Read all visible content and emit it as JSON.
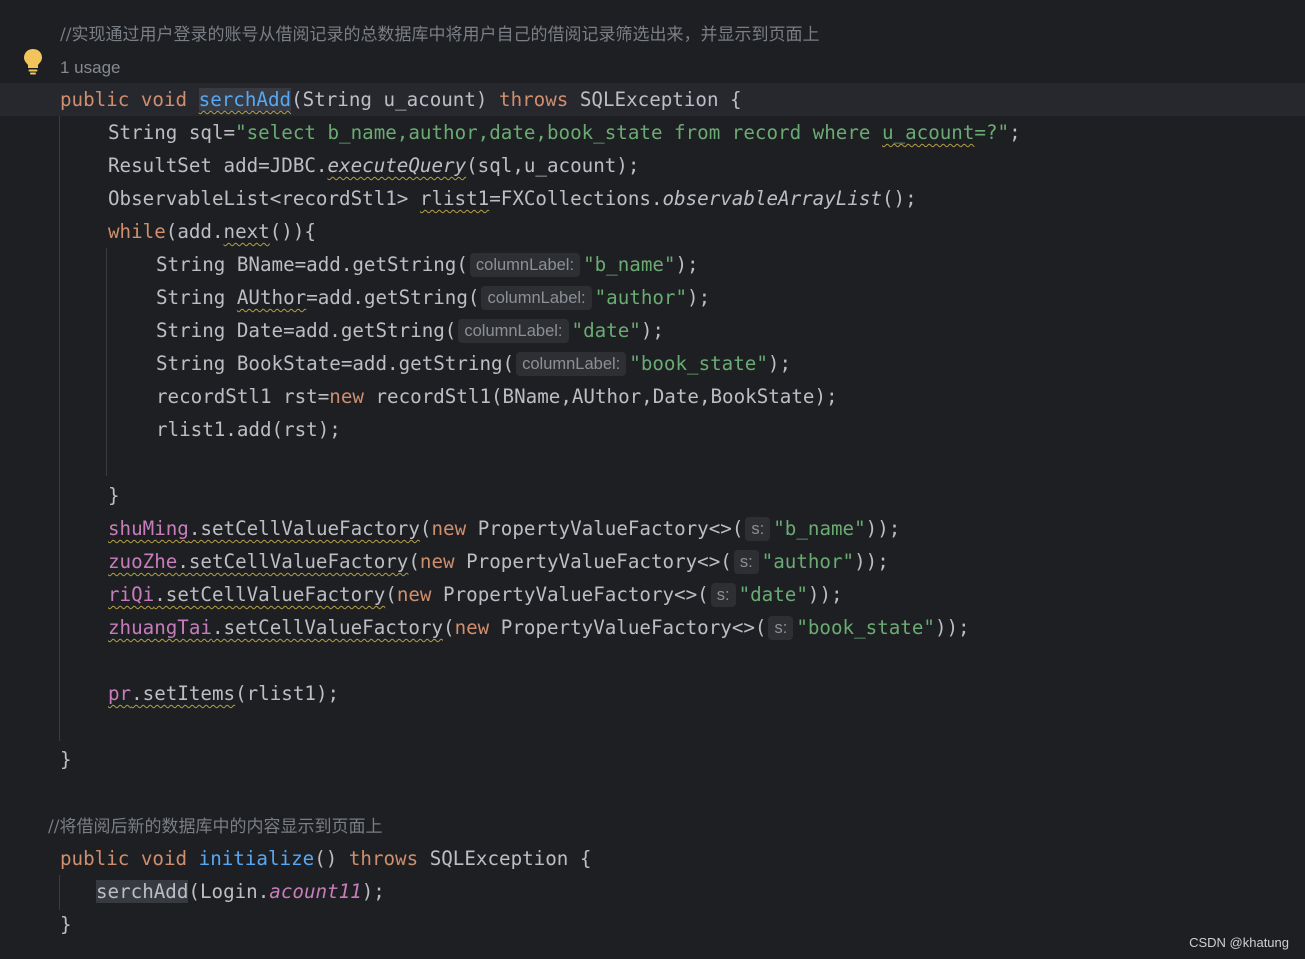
{
  "code": {
    "comment1": "//实现通过用户登录的账号从借阅记录的总数据库中将用户自己的借阅记录筛选出来，并显示到页面上",
    "usage": "1 usage",
    "l_sig": {
      "kw1": "public",
      "kw2": "void",
      "name": "serchAdd",
      "params": "(String u_acount) ",
      "kw3": "throws",
      "rest": " SQLException {"
    },
    "l_sql": {
      "a": "String sql=",
      "s1": "\"select b_name,author,date,book_state from record where ",
      "s2": "u_acount",
      "s3": "=?\"",
      "b": ";"
    },
    "l_rs": {
      "a": "ResultSet add=JDBC.",
      "m": "executeQuery",
      "b": "(sql,u_acount);"
    },
    "l_ol": {
      "a": "ObservableList<recordStl1> ",
      "v": "rlist1",
      "b": "=FXCollections.",
      "m": "observableArrayList",
      "c": "();"
    },
    "l_while": {
      "kw": "while",
      "a": "(add.",
      "m": "next",
      "b": "()){"
    },
    "l_b1": {
      "a": "String BName=add.getString(",
      "hint": "columnLabel:",
      "s": "\"b_name\"",
      "b": ");"
    },
    "l_b2": {
      "a": "String ",
      "v": "AUthor",
      "b": "=add.getString(",
      "hint": "columnLabel:",
      "s": "\"author\"",
      "c": ");"
    },
    "l_b3": {
      "a": "String Date=add.getString(",
      "hint": "columnLabel:",
      "s": "\"date\"",
      "b": ");"
    },
    "l_b4": {
      "a": "String BookState=add.getString(",
      "hint": "columnLabel:",
      "s": "\"book_state\"",
      "b": ");"
    },
    "l_b5": {
      "a": "recordStl1 rst=",
      "kw": "new",
      "b": " recordStl1(BName,AUthor,Date,BookState);"
    },
    "l_b6": {
      "a": "rlist1.add(rst);"
    },
    "close_brace": "}",
    "l_f1": {
      "f": "shuMing",
      "m": ".setCellValueFactory",
      "a": "(",
      "kw": "new",
      "b": " PropertyValueFactory<>(",
      "hint": "s:",
      "s": "\"b_name\"",
      "c": "));"
    },
    "l_f2": {
      "f": "zuoZhe",
      "m": ".setCellValueFactory",
      "a": "(",
      "kw": "new",
      "b": " PropertyValueFactory<>(",
      "hint": "s:",
      "s": "\"author\"",
      "c": "));"
    },
    "l_f3": {
      "f": "riQi",
      "m": ".setCellValueFactory",
      "a": "(",
      "kw": "new",
      "b": " PropertyValueFactory<>(",
      "hint": "s:",
      "s": "\"date\"",
      "c": "));"
    },
    "l_f4": {
      "f": "zhuangTai",
      "m": ".setCellValueFactory",
      "a": "(",
      "kw": "new",
      "b": " PropertyValueFactory<>(",
      "hint": "s:",
      "s": "\"book_state\"",
      "c": "));"
    },
    "l_pr": {
      "f": "pr",
      "m": ".setItems",
      "a": "(rlist1);"
    },
    "comment2": "//将借阅后新的数据库中的内容显示到页面上",
    "l_init": {
      "kw1": "public",
      "kw2": "void",
      "name": "initialize",
      "a": "() ",
      "kw3": "throws",
      "b": " SQLException {"
    },
    "l_call": {
      "m": "serchAdd",
      "a": "(Login.",
      "f": "acount11",
      "b": ");"
    }
  },
  "watermark": "CSDN @khatung",
  "colors": {
    "background": "#1e1f22",
    "text": "#bcbec4",
    "keyword": "#cf8e6d",
    "string": "#6aab73",
    "function": "#56a8f5",
    "field": "#c77dbb",
    "comment": "#7a7e85"
  },
  "icons": [
    "lightbulb-icon"
  ]
}
